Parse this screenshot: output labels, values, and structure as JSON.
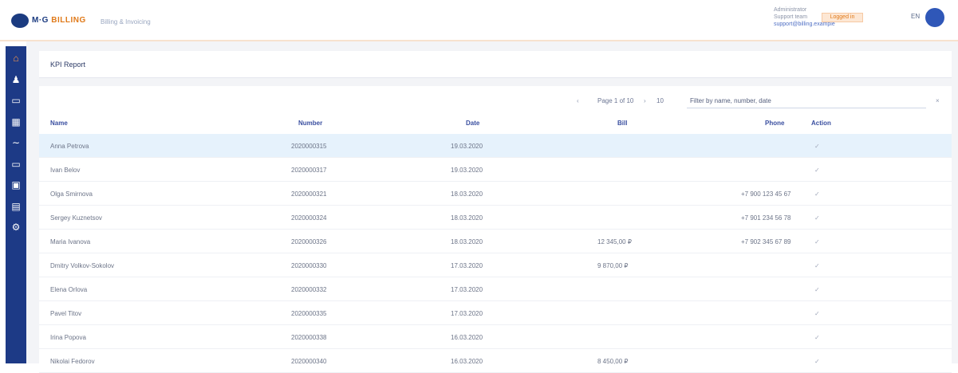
{
  "header": {
    "brand_prefix": "M·G",
    "brand_main": "BILLING",
    "brand_sub": "Billing & Invoicing",
    "account_line1": "Administrator",
    "account_line2": "Support team",
    "account_line3": "support@billing.example",
    "warning_label": "Logged in",
    "language": "EN"
  },
  "sidebar": {
    "items": [
      {
        "icon": "home-icon",
        "glyph": "⌂",
        "active": true
      },
      {
        "icon": "user-icon",
        "glyph": "♟",
        "active": false
      },
      {
        "icon": "comment-icon",
        "glyph": "▭",
        "active": false
      },
      {
        "icon": "calendar-icon",
        "glyph": "▦",
        "active": false
      },
      {
        "icon": "chart-line-icon",
        "glyph": "∼",
        "active": false
      },
      {
        "icon": "inbox-icon",
        "glyph": "▭",
        "active": false
      },
      {
        "icon": "wallet-icon",
        "glyph": "▣",
        "active": false
      },
      {
        "icon": "list-icon",
        "glyph": "▤",
        "active": false
      },
      {
        "icon": "gear-icon",
        "glyph": "⚙",
        "active": false
      }
    ]
  },
  "breadcrumb": {
    "title": "KPI Report"
  },
  "toolbar": {
    "page_prev": "‹",
    "page_range": "Page 1 of 10",
    "page_next": "›",
    "page_size": "10",
    "filter_label": "Filter by name, number, date",
    "clear": "×"
  },
  "table": {
    "columns": [
      "Name",
      "Number",
      "Date",
      "Bill",
      "Phone",
      "Action"
    ],
    "rows": [
      {
        "name": "Anna Petrova",
        "number": "2020000315",
        "date": "19.03.2020",
        "bill": "",
        "phone": "",
        "action": "✓",
        "selected": true
      },
      {
        "name": "Ivan Belov",
        "number": "2020000317",
        "date": "19.03.2020",
        "bill": "",
        "phone": "",
        "action": "✓",
        "selected": false
      },
      {
        "name": "Olga Smirnova",
        "number": "2020000321",
        "date": "18.03.2020",
        "bill": "",
        "phone": "+7 900 123 45 67",
        "action": "✓",
        "selected": false
      },
      {
        "name": "Sergey Kuznetsov",
        "number": "2020000324",
        "date": "18.03.2020",
        "bill": "",
        "phone": "+7 901 234 56 78",
        "action": "✓",
        "selected": false
      },
      {
        "name": "Maria Ivanova",
        "number": "2020000326",
        "date": "18.03.2020",
        "bill": "12 345,00 ₽",
        "phone": "+7 902 345 67 89",
        "action": "✓",
        "selected": false
      },
      {
        "name": "Dmitry Volkov-Sokolov",
        "number": "2020000330",
        "date": "17.03.2020",
        "bill": "9 870,00 ₽",
        "phone": "",
        "action": "✓",
        "selected": false
      },
      {
        "name": "Elena Orlova",
        "number": "2020000332",
        "date": "17.03.2020",
        "bill": "",
        "phone": "",
        "action": "✓",
        "selected": false
      },
      {
        "name": "Pavel Titov",
        "number": "2020000335",
        "date": "17.03.2020",
        "bill": "",
        "phone": "",
        "action": "✓",
        "selected": false
      },
      {
        "name": "Irina Popova",
        "number": "2020000338",
        "date": "16.03.2020",
        "bill": "",
        "phone": "",
        "action": "✓",
        "selected": false
      },
      {
        "name": "Nikolai Fedorov",
        "number": "2020000340",
        "date": "16.03.2020",
        "bill": "8 450,00 ₽",
        "phone": "",
        "action": "✓",
        "selected": false
      }
    ]
  },
  "colors": {
    "sidebar": "#1d3a86",
    "accent": "#e07a1a",
    "header_text": "#3a4fa0",
    "selected_row": "#e6f2fc"
  }
}
